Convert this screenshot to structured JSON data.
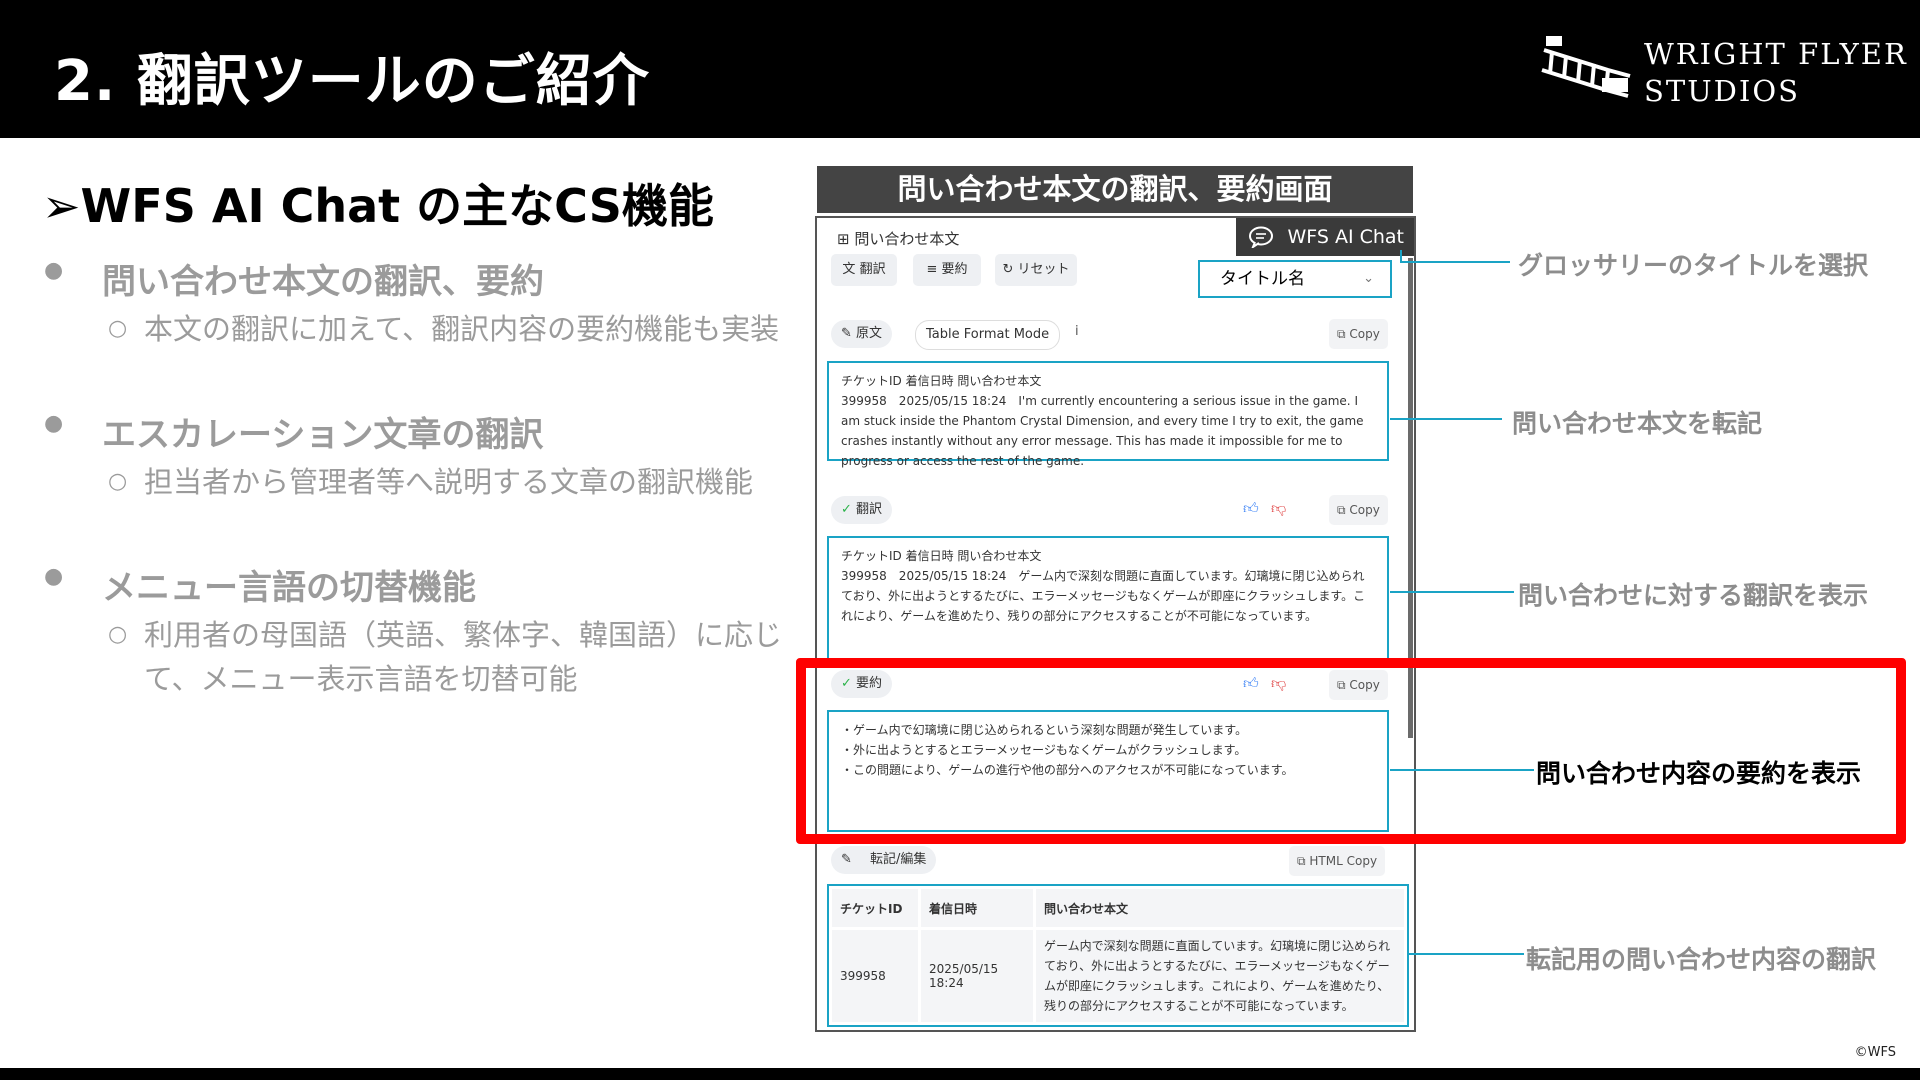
{
  "slide": {
    "title": "2. 翻訳ツールのご紹介",
    "logo_line1": "WRIGHT FLYER",
    "logo_line2": "STUDIOS",
    "copyright": "©WFS"
  },
  "left": {
    "heading": "➢WFS AI Chat の主なCS機能",
    "items": [
      {
        "title": "問い合わせ本文の翻訳、要約",
        "sub": "本文の翻訳に加えて、翻訳内容の要約機能も実装"
      },
      {
        "title": "エスカレーション文章の翻訳",
        "sub": "担当者から管理者等へ説明する文章の翻訳機能"
      },
      {
        "title": "メニュー言語の切替機能",
        "sub": "利用者の母国語（英語、繁体字、韓国語）に応じて、メニュー表示言語を切替可能"
      }
    ]
  },
  "screenshot": {
    "title": "問い合わせ本文の翻訳、要約画面",
    "badge": "WFS AI Chat",
    "inquiry_label": "問い合わせ本文",
    "btn_translate": "翻訳",
    "btn_summary": "要約",
    "btn_reset": "リセット",
    "title_select": "タイトル名",
    "original": {
      "tag": "原文",
      "mode": "Table Format Mode",
      "info": "i",
      "copy": "Copy",
      "header": "チケットID  着信日時  問い合わせ本文",
      "body": "399958　2025/05/15 18:24　I'm currently encountering a serious issue in the game. I am stuck inside the Phantom Crystal Dimension, and every time I try to exit, the game crashes instantly without any error message. This has made it impossible for me to progress or access the rest of the game."
    },
    "translation": {
      "tag": "翻訳",
      "copy": "Copy",
      "header": "チケットID  着信日時  問い合わせ本文",
      "body": "399958　2025/05/15 18:24　ゲーム内で深刻な問題に直面しています。幻璃境に閉じ込められており、外に出ようとするたびに、エラーメッセージもなくゲームが即座にクラッシュします。これにより、ゲームを進めたり、残りの部分にアクセスすることが不可能になっています。"
    },
    "summary": {
      "tag": "要約",
      "copy": "Copy",
      "lines": [
        "・ゲーム内で幻璃境に閉じ込められるという深刻な問題が発生しています。",
        "・外に出ようとするとエラーメッセージもなくゲームがクラッシュします。",
        "・この問題により、ゲームの進行や他の部分へのアクセスが不可能になっています。"
      ]
    },
    "transcript": {
      "tag": "転記/編集",
      "copy": "HTML Copy",
      "columns": [
        "チケットID",
        "着信日時",
        "問い合わせ本文"
      ],
      "row": {
        "id": "399958",
        "date": "2025/05/15 18:24",
        "text": "ゲーム内で深刻な問題に直面しています。幻璃境に閉じ込められており、外に出ようとするたびに、エラーメッセージもなくゲームが即座にクラッシュします。これにより、ゲームを進めたり、残りの部分にアクセスすることが不可能になっています。"
      }
    }
  },
  "callouts": {
    "glossary": "グロッサリーのタイトルを選択",
    "transcribe": "問い合わせ本文を転記",
    "translation": "問い合わせに対する翻訳を表示",
    "summary": "問い合わせ内容の要約を表示",
    "transcript": "転記用の問い合わせ内容の翻訳"
  },
  "colors": {
    "accent": "#1aa3c5",
    "highlight": "#ff0000",
    "header_bg": "#000000"
  }
}
